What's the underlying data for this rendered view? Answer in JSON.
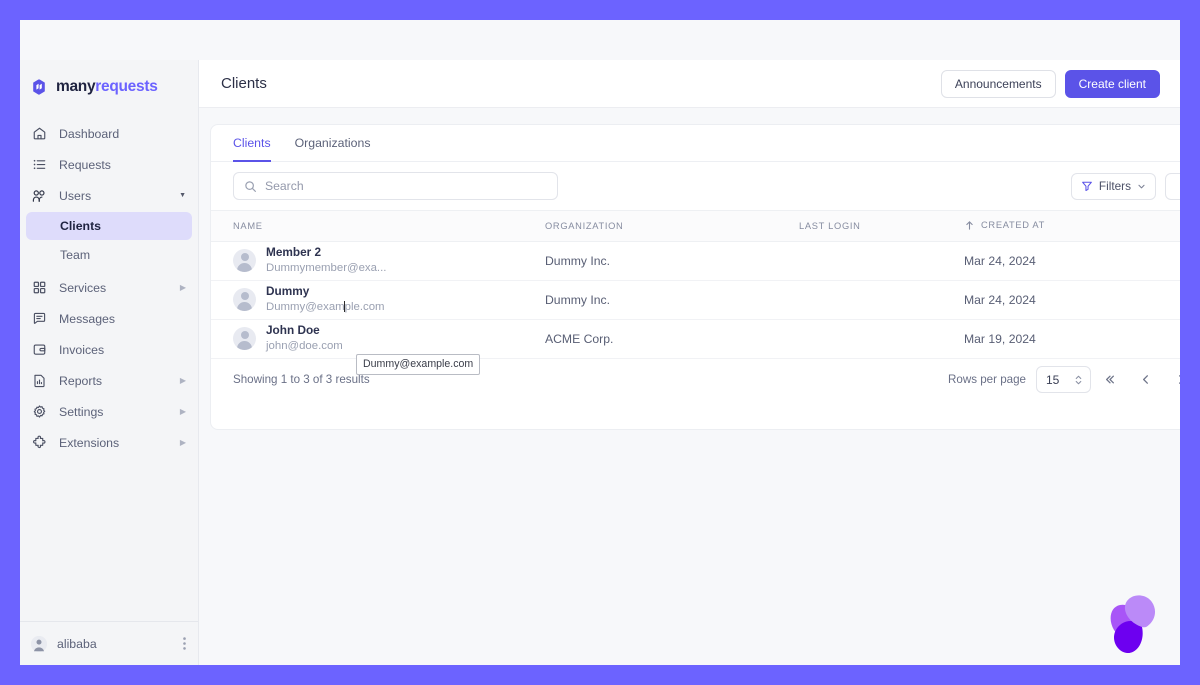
{
  "brand": {
    "name_part1": "many",
    "name_part2": "requests",
    "logo_icon": "manyrequests-logo-icon",
    "accent_color": "#5b53e8",
    "frame_color": "#6c63ff"
  },
  "sidebar": {
    "items": [
      {
        "label": "Dashboard",
        "icon": "home-icon",
        "caret": "",
        "active": false
      },
      {
        "label": "Requests",
        "icon": "list-icon",
        "caret": "",
        "active": false
      },
      {
        "label": "Users",
        "icon": "users-icon",
        "caret": "▼",
        "active": false
      },
      {
        "label": "Services",
        "icon": "grid-icon",
        "caret": "▶",
        "active": false
      },
      {
        "label": "Messages",
        "icon": "message-icon",
        "caret": "",
        "active": false
      },
      {
        "label": "Invoices",
        "icon": "wallet-icon",
        "caret": "",
        "active": false
      },
      {
        "label": "Reports",
        "icon": "chart-icon",
        "caret": "▶",
        "active": false
      },
      {
        "label": "Settings",
        "icon": "gear-icon",
        "caret": "▶",
        "active": false
      },
      {
        "label": "Extensions",
        "icon": "puzzle-icon",
        "caret": "▶",
        "active": false
      }
    ],
    "sub_items": [
      {
        "label": "Clients",
        "active": true
      },
      {
        "label": "Team",
        "active": false
      }
    ],
    "footer": {
      "user": "alibaba",
      "avatar_icon": "user-avatar-icon",
      "menu_icon": "kebab-menu-icon"
    }
  },
  "header": {
    "title": "Clients",
    "announcements_label": "Announcements",
    "create_client_label": "Create client"
  },
  "card": {
    "tabs": [
      {
        "label": "Clients",
        "active": true
      },
      {
        "label": "Organizations",
        "active": false
      }
    ],
    "search": {
      "placeholder": "Search",
      "value": "",
      "icon": "search-icon"
    },
    "filters": {
      "label": "Filters",
      "icon": "funnel-icon",
      "chevron": "chevron-down-icon"
    },
    "table": {
      "columns": [
        {
          "key": "name",
          "label": "NAME",
          "sorted": false
        },
        {
          "key": "organization",
          "label": "ORGANIZATION",
          "sorted": false
        },
        {
          "key": "last_login",
          "label": "LAST LOGIN",
          "sorted": false
        },
        {
          "key": "created_at",
          "label": "CREATED AT",
          "sorted": true,
          "sort_icon": "sort-asc-arrow-icon"
        }
      ],
      "rows": [
        {
          "name": "Member 2",
          "email": "Dummymember@exa...",
          "organization": "Dummy Inc.",
          "last_login": "",
          "created_at": "Mar 24, 2024"
        },
        {
          "name": "Dummy",
          "email_before_caret": "Dummy@exam",
          "email_after_caret": "ple.com",
          "email": "Dummy@example.com",
          "organization": "Dummy Inc.",
          "last_login": "",
          "created_at": "Mar 24, 2024"
        },
        {
          "name": "John Doe",
          "email": "john@doe.com",
          "organization": "ACME Corp.",
          "last_login": "",
          "created_at": "Mar 19, 2024"
        }
      ]
    },
    "footer": {
      "results_text": "Showing 1 to 3 of 3 results",
      "rows_per_page_label": "Rows per page",
      "rows_per_page_value": "15",
      "pagination": [
        {
          "name": "first-page",
          "glyph": "«"
        },
        {
          "name": "prev-page",
          "glyph": "‹"
        },
        {
          "name": "next-page",
          "glyph": "›"
        }
      ]
    }
  },
  "tooltip": {
    "text": "Dummy@example.com"
  },
  "widget": {
    "icon": "pinwheel-chat-widget-icon"
  }
}
